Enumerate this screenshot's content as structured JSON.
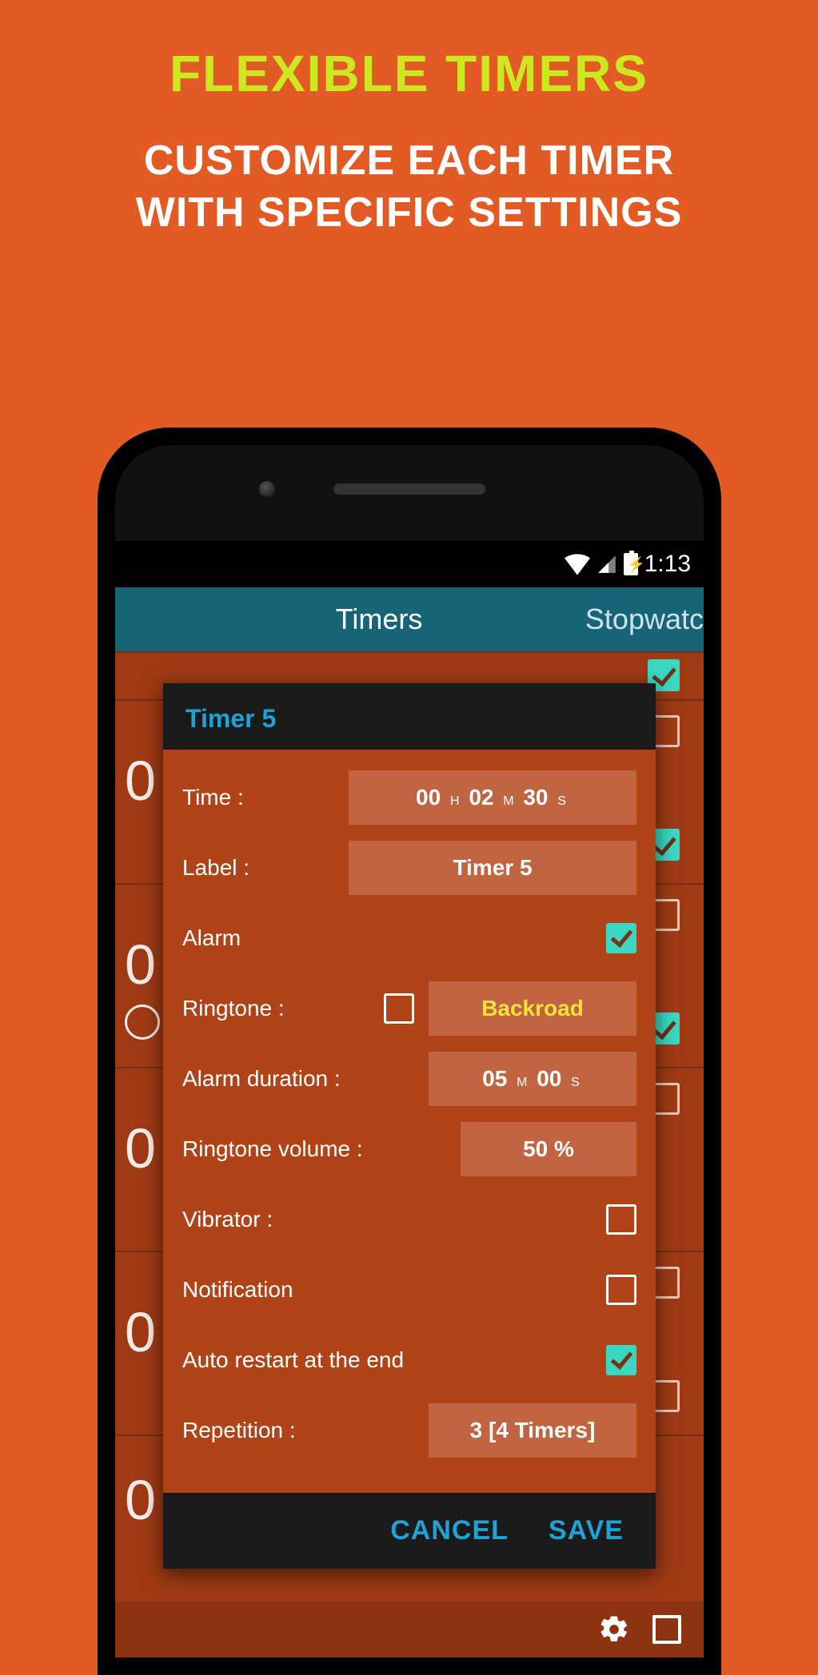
{
  "promo": {
    "title": "FLEXIBLE TIMERS",
    "subtitle_line1": "CUSTOMIZE EACH TIMER",
    "subtitle_line2": "WITH SPECIFIC SETTINGS"
  },
  "status": {
    "time": "1:13"
  },
  "tabs": {
    "timers": "Timers",
    "stopwatch": "Stopwatc"
  },
  "dialog": {
    "title": "Timer 5",
    "fields": {
      "time_label": "Time :",
      "time_value": {
        "h": "00",
        "m": "02",
        "s": "30",
        "h_unit": "H",
        "m_unit": "M",
        "s_unit": "S"
      },
      "label_label": "Label :",
      "label_value": "Timer 5",
      "alarm_label": "Alarm",
      "alarm_checked": true,
      "ringtone_label": "Ringtone :",
      "ringtone_checked": false,
      "ringtone_value": "Backroad",
      "duration_label": "Alarm duration :",
      "duration_value": {
        "m": "05",
        "s": "00",
        "m_unit": "M",
        "s_unit": "S"
      },
      "volume_label": "Ringtone volume :",
      "volume_value": "50 %",
      "vibrator_label": "Vibrator :",
      "vibrator_checked": false,
      "notification_label": "Notification",
      "notification_checked": false,
      "autorestart_label": "Auto restart at the end",
      "autorestart_checked": true,
      "repetition_label": "Repetition :",
      "repetition_value": "3 [4 Timers]"
    },
    "actions": {
      "cancel": "CANCEL",
      "save": "SAVE"
    }
  },
  "background": {
    "time_fragment": "0"
  }
}
